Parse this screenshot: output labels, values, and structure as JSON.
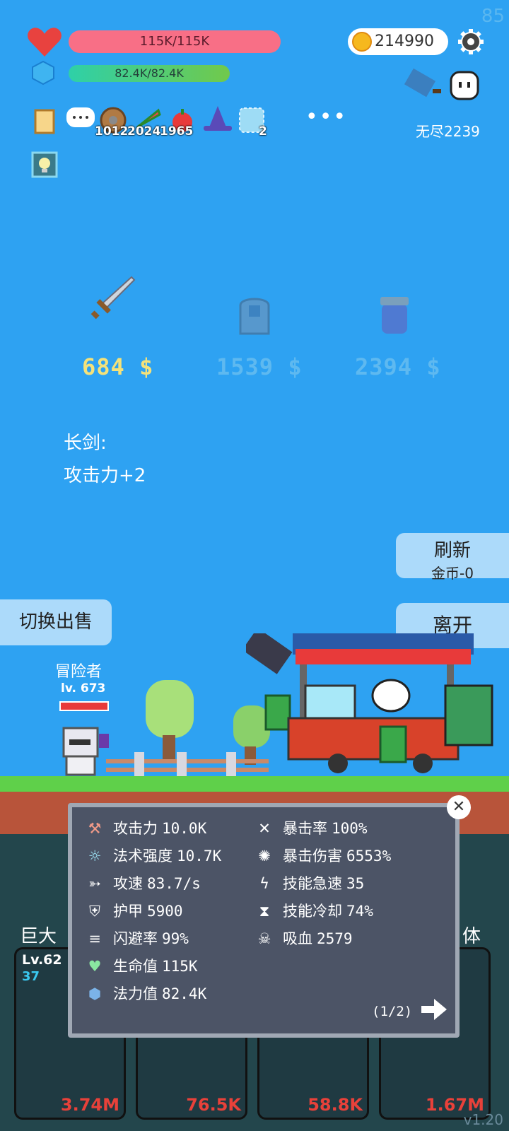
{
  "fps": "85",
  "hp": {
    "label": "115K/115K"
  },
  "mp": {
    "label": "82.4K/82.4K"
  },
  "coins": "214990",
  "endless": "无尽2239",
  "buff_counts": {
    "shield": "1012",
    "buff2": "2024",
    "buff3": "1965",
    "blank": "2"
  },
  "shop": {
    "items": [
      {
        "name": "sword",
        "price": "684 $",
        "color": "#f4e27a"
      },
      {
        "name": "armor",
        "price": "1539 $",
        "color": "#8fd0f0"
      },
      {
        "name": "potion",
        "price": "2394 $",
        "color": "#8fd0f0"
      }
    ],
    "desc_title": "长剑:",
    "desc_text": "攻击力+2"
  },
  "buttons": {
    "refresh": "刷新",
    "refresh_cost": "金币-0",
    "leave": "离开",
    "switch": "切换出售"
  },
  "hero": {
    "name": "冒险者",
    "level": "lv. 673"
  },
  "stats_left": [
    {
      "icon": "axe-icon",
      "label": "攻击力",
      "value": "10.0K",
      "color": "#f09a88"
    },
    {
      "icon": "sun-icon",
      "label": "法术强度",
      "value": "10.7K",
      "color": "#9de4f7"
    },
    {
      "icon": "bow-icon",
      "label": "攻速",
      "value": "83.7/s",
      "color": "#ffffff"
    },
    {
      "icon": "shield-icon",
      "label": "护甲",
      "value": "5900",
      "color": "#ffffff"
    },
    {
      "icon": "lines-icon",
      "label": "闪避率",
      "value": "99%",
      "color": "#ffffff"
    },
    {
      "icon": "heart-icon",
      "label": "生命值",
      "value": "115K",
      "color": "#8ae6a0"
    },
    {
      "icon": "crystal-icon",
      "label": "法力值",
      "value": "82.4K",
      "color": "#7bb3e8"
    }
  ],
  "stats_right": [
    {
      "icon": "crit-icon",
      "label": "暴击率",
      "value": "100%",
      "color": "#ffffff"
    },
    {
      "icon": "burst-icon",
      "label": "暴击伤害",
      "value": "6553%",
      "color": "#ffffff"
    },
    {
      "icon": "lightning-icon",
      "label": "技能急速",
      "value": "35",
      "color": "#ffffff"
    },
    {
      "icon": "hourglass-icon",
      "label": "技能冷却",
      "value": "74%",
      "color": "#ffffff"
    },
    {
      "icon": "skull-icon",
      "label": "吸血",
      "value": "2579",
      "color": "#ffffff"
    }
  ],
  "page": "(1/2)",
  "bottom": {
    "left_title": "巨大",
    "right_title": "体",
    "card_level": "Lv.62",
    "card_sub": "37",
    "values": [
      "3.74M",
      "76.5K",
      "58.8K",
      "1.67M"
    ]
  },
  "version": "v1.20"
}
